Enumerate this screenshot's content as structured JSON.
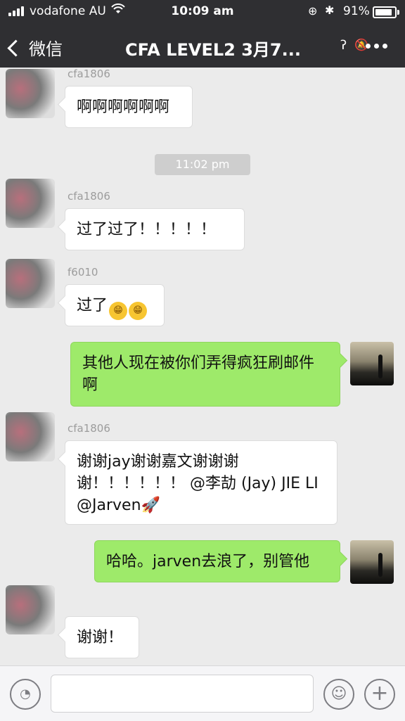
{
  "status_bar": {
    "carrier": "vodafone AU",
    "time": "10:09 am",
    "battery_percent": "91%",
    "battery_level": 0.91,
    "signal_bars": 4
  },
  "nav": {
    "back_label": "微信",
    "title": "CFA LEVEL2 3月7..."
  },
  "messages": {
    "m1_sender": "cfa1806",
    "m1_text": "啊啊啊啊啊啊",
    "time_divider": "11:02 pm",
    "m2_sender": "cfa1806",
    "m2_text": "过了过了！！！！！",
    "m3_sender": "f6010",
    "m3_text": "过了",
    "m3_emoji_1": "😁",
    "m3_emoji_2": "😁",
    "m4_text": "其他人现在被你们弄得疯狂刷邮件啊",
    "m5_sender": "cfa1806",
    "m5_text": "谢谢jay谢谢嘉文谢谢谢谢！！！！！！ @李劼 (Jay) JIE LI @Jarven🚀",
    "m6_text": "哈哈。jarven去浪了，别管他",
    "m7_text": "谢谢！"
  },
  "input_bar": {
    "voice_icon": "voice-icon",
    "emoji_icon": "emoji-icon",
    "plus_icon": "plus-icon"
  },
  "colors": {
    "header_bg": "#2f2f32",
    "chat_bg": "#ebebeb",
    "outgoing_bubble": "#9eea6a",
    "incoming_bubble": "#ffffff"
  }
}
